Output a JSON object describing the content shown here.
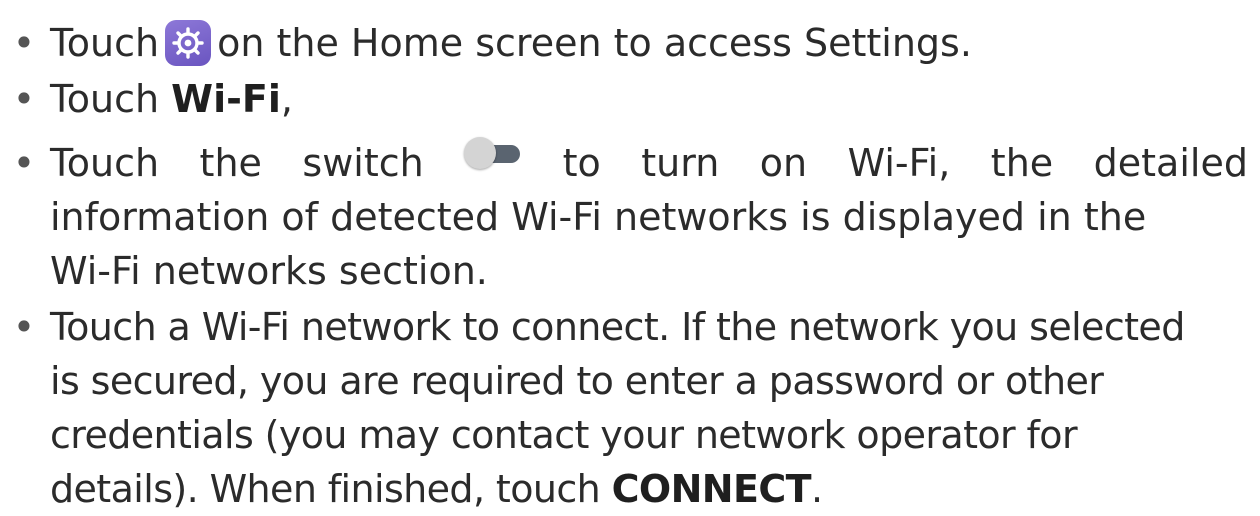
{
  "bullet_char": "•",
  "items": [
    {
      "before_icon": "Touch",
      "icon": "settings-gear-icon",
      "after_icon": "on the Home screen to access Settings."
    },
    {
      "prefix": "Touch ",
      "bold": "Wi-Fi",
      "suffix": ","
    },
    {
      "line1_words": [
        "Touch",
        "the",
        "switch",
        "",
        "to",
        "turn",
        "on",
        "Wi-Fi,",
        "the",
        "detailed"
      ],
      "line2": "information of detected Wi-Fi networks is displayed in the",
      "line3": "Wi-Fi networks section."
    },
    {
      "line1": "Touch a Wi-Fi network to connect. If the network you selected",
      "line2": "is secured, you are required to enter a password or other",
      "line3": "credentials (you may contact your network operator for",
      "line4_prefix": "details). When finished, touch ",
      "line4_bold": "CONNECT",
      "line4_suffix": "."
    }
  ],
  "colors": {
    "text": "#2b2b2b",
    "icon_bg": "#7a64cc",
    "switch_track": "#5a6470",
    "switch_knob": "#d4d4d4"
  }
}
